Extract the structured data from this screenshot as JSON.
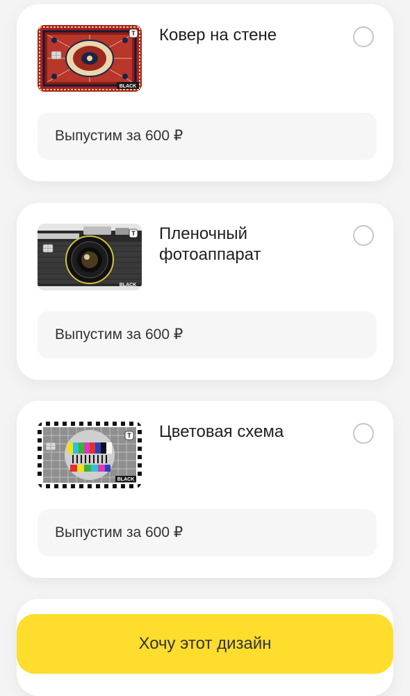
{
  "cards": [
    {
      "title": "Ковер на стене",
      "price_label": "Выпустим за 600 ₽",
      "card_badge": "BLACK",
      "logo_letter": "T",
      "selected": false
    },
    {
      "title": "Пленочный фотоаппарат",
      "price_label": "Выпустим за 600 ₽",
      "card_badge": "BLACK",
      "logo_letter": "T",
      "selected": false
    },
    {
      "title": "Цветовая схема",
      "price_label": "Выпустим за 600 ₽",
      "card_badge": "BLACK",
      "logo_letter": "T",
      "selected": false
    }
  ],
  "cta": {
    "label": "Хочу этот дизайн"
  },
  "colors": {
    "accent": "#ffdd2d",
    "background": "#f4f4f5",
    "card": "#ffffff",
    "price_box": "#f6f6f7",
    "radio_border": "#c6c6c8"
  }
}
